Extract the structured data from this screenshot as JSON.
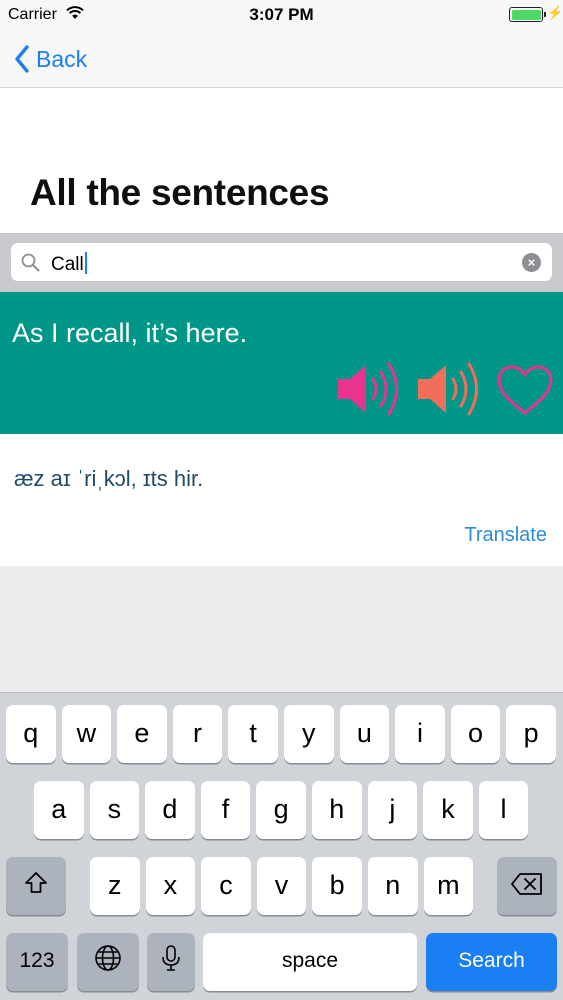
{
  "status_bar": {
    "carrier": "Carrier",
    "time": "3:07 PM",
    "battery_level": 1.0,
    "battery_color": "#4cd964"
  },
  "nav": {
    "back_label": "Back",
    "back_icon": "chevron-left-icon",
    "tint": "#1b7ff0"
  },
  "header": {
    "title": "All the sentences"
  },
  "search": {
    "query": "Call",
    "icon": "magnifier-icon",
    "clear_icon": "clear-circle-icon"
  },
  "result": {
    "sentence": "As I recall, it’s here.",
    "card_color": "#009688",
    "actions": [
      {
        "name": "speaker-normal-icon",
        "color": "#e8338f"
      },
      {
        "name": "speaker-slow-icon",
        "color": "#f06e5a"
      },
      {
        "name": "heart-icon",
        "color": "#e8338f"
      }
    ],
    "ipa": "æz aɪ ˈriˌkɔl, ɪts hir.",
    "translate_label": "Translate"
  },
  "keyboard": {
    "row1": [
      "q",
      "w",
      "e",
      "r",
      "t",
      "y",
      "u",
      "i",
      "o",
      "p"
    ],
    "row2": [
      "a",
      "s",
      "d",
      "f",
      "g",
      "h",
      "j",
      "k",
      "l"
    ],
    "row3": [
      "z",
      "x",
      "c",
      "v",
      "b",
      "n",
      "m"
    ],
    "shift_icon": "shift-icon",
    "delete_icon": "backspace-icon",
    "numbers_label": "123",
    "globe_icon": "globe-icon",
    "mic_icon": "microphone-icon",
    "space_label": "space",
    "search_label": "Search",
    "search_color": "#1a7ff2"
  }
}
